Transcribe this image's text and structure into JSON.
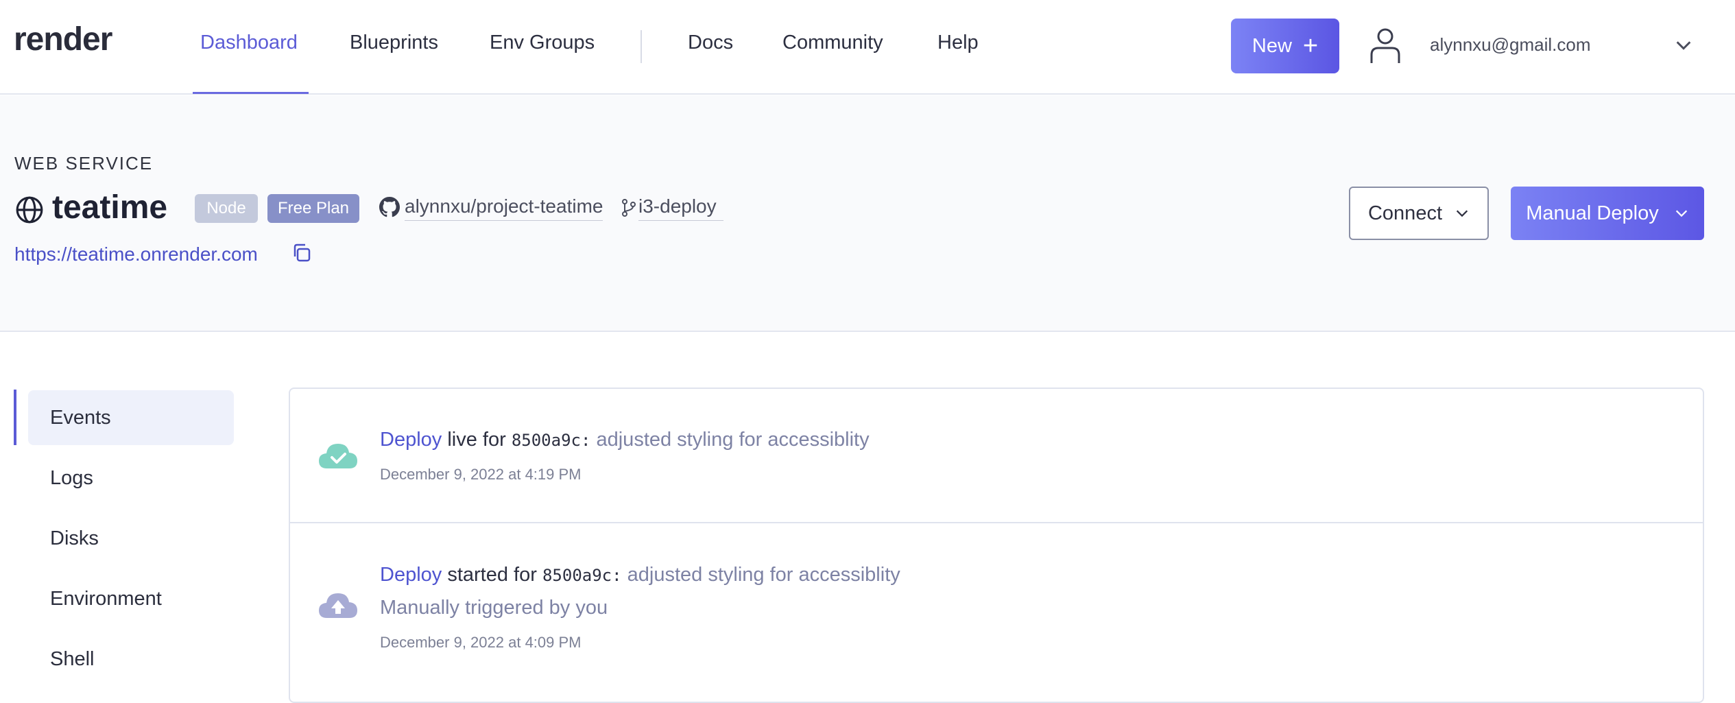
{
  "brand": "render",
  "nav": {
    "primary": [
      "Dashboard",
      "Blueprints",
      "Env Groups"
    ],
    "secondary": [
      "Docs",
      "Community",
      "Help"
    ],
    "active": "Dashboard",
    "new_label": "New",
    "user_email": "alynnxu@gmail.com"
  },
  "service": {
    "type_label": "WEB SERVICE",
    "name": "teatime",
    "runtime_badge": "Node",
    "plan_badge": "Free Plan",
    "repo": "alynnxu/project-teatime",
    "branch": "i3-deploy",
    "url": "https://teatime.onrender.com",
    "connect_label": "Connect",
    "manual_deploy_label": "Manual Deploy"
  },
  "sidebar": {
    "items": [
      "Events",
      "Logs",
      "Disks",
      "Environment",
      "Shell"
    ],
    "active": "Events"
  },
  "events": [
    {
      "status": "live",
      "icon": "cloud-check-icon",
      "link_text": "Deploy",
      "verb": "live for",
      "commit": "8500a9c:",
      "message": "adjusted styling for accessiblity",
      "note": "",
      "time": "December 9, 2022 at 4:19 PM"
    },
    {
      "status": "started",
      "icon": "cloud-upload-icon",
      "link_text": "Deploy",
      "verb": "started for",
      "commit": "8500a9c:",
      "message": "adjusted styling for accessiblity",
      "note": "Manually triggered by you",
      "time": "December 9, 2022 at 4:09 PM"
    }
  ],
  "colors": {
    "accent": "#5b5bd6",
    "success": "#7fd3c2",
    "pending": "#a7abd4",
    "header_bg": "#f9fafc"
  }
}
